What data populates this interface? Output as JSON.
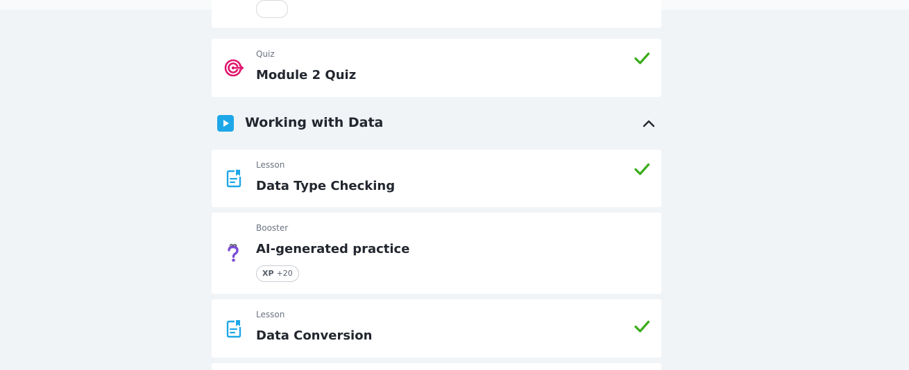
{
  "colors": {
    "background": "#f1f4f7",
    "card": "#ffffff",
    "check": "#3bab1a",
    "quiz_icon": "#e0156c",
    "lesson_icon": "#1ea7e8",
    "booster_icon": "#7b4dd6",
    "section_play": "#1ea7e8"
  },
  "items": [
    {
      "type": "Quiz",
      "title": "Module 2 Quiz",
      "icon": "target-icon",
      "completed": true
    },
    {
      "type": "Lesson",
      "title": "Data Type Checking",
      "icon": "lesson-document-icon",
      "completed": true
    },
    {
      "type": "Booster",
      "title": "AI-generated practice",
      "icon": "question-mascot-icon",
      "completed": false,
      "xp_label": "XP",
      "xp_value": "+20"
    },
    {
      "type": "Lesson",
      "title": "Data Conversion",
      "icon": "lesson-document-icon",
      "completed": true
    }
  ],
  "section": {
    "title": "Working with Data",
    "icon": "play-icon",
    "toggle_icon": "chevron-up-icon",
    "expanded": true
  }
}
